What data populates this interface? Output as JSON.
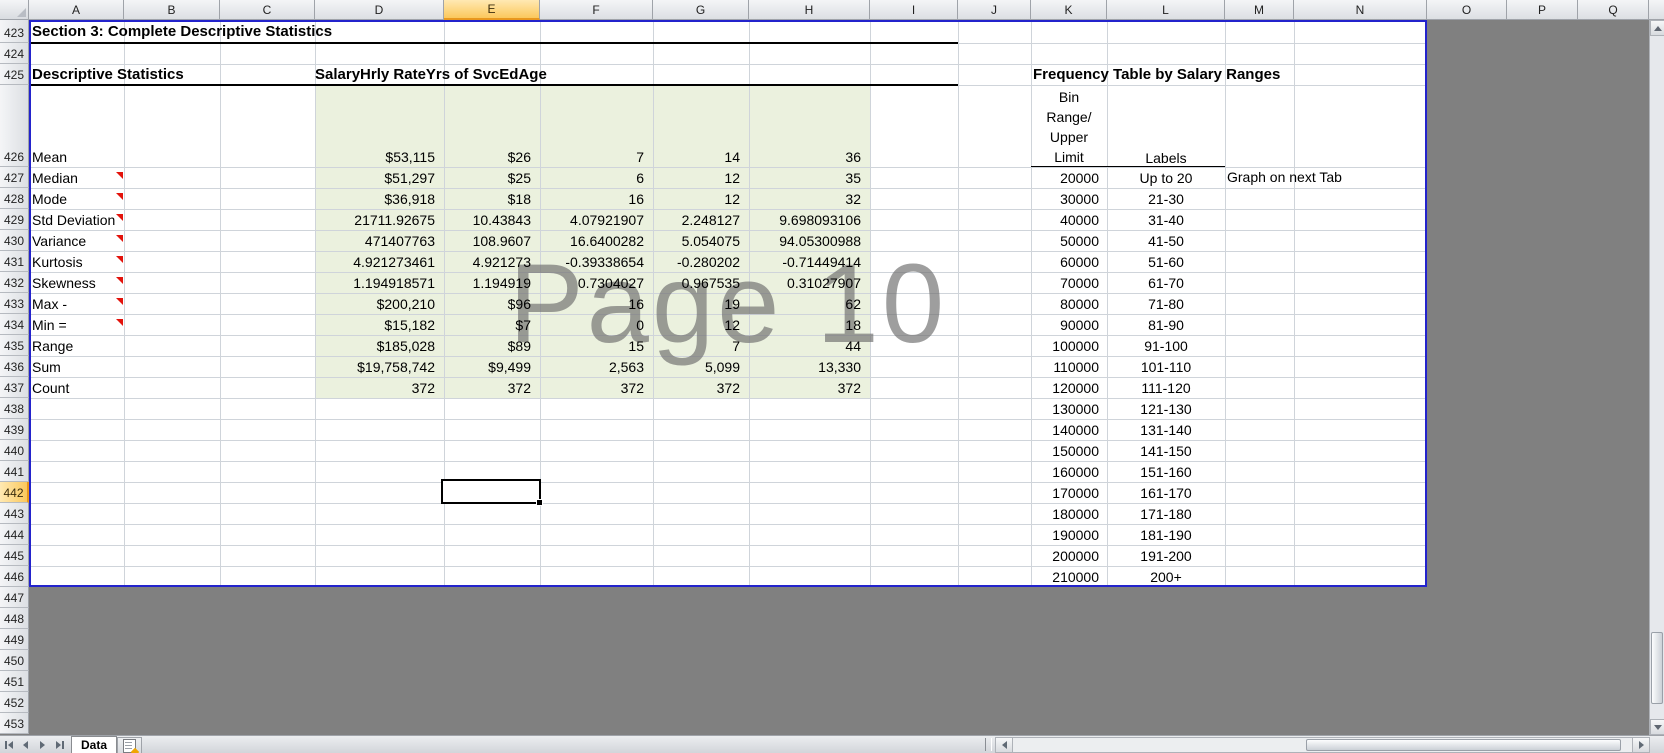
{
  "window": {
    "watermark": "Page 10"
  },
  "section": {
    "title": "Section 3: Complete Descriptive Statistics"
  },
  "grid": {
    "selected_cell": "E442",
    "columns": [
      {
        "label": "A"
      },
      {
        "label": "B"
      },
      {
        "label": "C"
      },
      {
        "label": "D"
      },
      {
        "label": "E",
        "selected": true
      },
      {
        "label": "F"
      },
      {
        "label": "G"
      },
      {
        "label": "H"
      },
      {
        "label": "I"
      },
      {
        "label": "J"
      },
      {
        "label": "K"
      },
      {
        "label": "L"
      },
      {
        "label": "M"
      },
      {
        "label": "N"
      },
      {
        "label": "O"
      },
      {
        "label": "P"
      },
      {
        "label": "Q"
      }
    ],
    "rows": [
      {
        "label": "423"
      },
      {
        "label": "424"
      },
      {
        "label": "425"
      },
      {
        "label": "426"
      },
      {
        "label": "427"
      },
      {
        "label": "428"
      },
      {
        "label": "429"
      },
      {
        "label": "430"
      },
      {
        "label": "431"
      },
      {
        "label": "432"
      },
      {
        "label": "433"
      },
      {
        "label": "434"
      },
      {
        "label": "435"
      },
      {
        "label": "436"
      },
      {
        "label": "437"
      },
      {
        "label": "438"
      },
      {
        "label": "439"
      },
      {
        "label": "440"
      },
      {
        "label": "441"
      },
      {
        "label": "442",
        "selected": true
      },
      {
        "label": "443"
      },
      {
        "label": "444"
      },
      {
        "label": "445"
      },
      {
        "label": "446"
      },
      {
        "label": "447"
      },
      {
        "label": "448"
      },
      {
        "label": "449"
      },
      {
        "label": "450"
      },
      {
        "label": "451"
      },
      {
        "label": "452"
      },
      {
        "label": "453"
      }
    ]
  },
  "stats_table": {
    "title": "Descriptive Statistics",
    "columns": [
      {
        "label": "Salary"
      },
      {
        "label": "Hrly Rate"
      },
      {
        "label": "Yrs of Svc"
      },
      {
        "label": "Ed"
      },
      {
        "label": "Age"
      }
    ],
    "rows": [
      {
        "label": "Mean",
        "comment": false,
        "values": [
          "$53,115",
          "$26",
          "7",
          "14",
          "36"
        ]
      },
      {
        "label": "Median",
        "comment": true,
        "values": [
          "$51,297",
          "$25",
          "6",
          "12",
          "35"
        ]
      },
      {
        "label": "Mode",
        "comment": true,
        "values": [
          "$36,918",
          "$18",
          "16",
          "12",
          "32"
        ]
      },
      {
        "label": "Std Deviation",
        "comment": true,
        "values": [
          "21711.92675",
          "10.43843",
          "4.07921907",
          "2.248127",
          "9.698093106"
        ]
      },
      {
        "label": "Variance",
        "comment": true,
        "values": [
          "471407763",
          "108.9607",
          "16.6400282",
          "5.054075",
          "94.05300988"
        ]
      },
      {
        "label": "Kurtosis",
        "comment": true,
        "values": [
          "4.921273461",
          "4.921273",
          "-0.39338654",
          "-0.280202",
          "-0.71449414"
        ]
      },
      {
        "label": "Skewness",
        "comment": true,
        "values": [
          "1.194918571",
          "1.194919",
          "0.7304027",
          "0.967535",
          "0.31027907"
        ]
      },
      {
        "label": "Max -",
        "comment": true,
        "values": [
          "$200,210",
          "$96",
          "16",
          "19",
          "62"
        ]
      },
      {
        "label": "Min =",
        "comment": true,
        "values": [
          "$15,182",
          "$7",
          "0",
          "12",
          "18"
        ]
      },
      {
        "label": "Range",
        "comment": false,
        "values": [
          "$185,028",
          "$89",
          "15",
          "7",
          "44"
        ]
      },
      {
        "label": "Sum",
        "comment": false,
        "values": [
          "$19,758,742",
          "$9,499",
          "2,563",
          "5,099",
          "13,330"
        ]
      },
      {
        "label": "Count",
        "comment": false,
        "values": [
          "372",
          "372",
          "372",
          "372",
          "372"
        ]
      }
    ]
  },
  "freq_table": {
    "title": "Frequency Table by Salary Ranges",
    "bin_header": "Bin\nRange/\nUpper\nLimit",
    "labels_header": "Labels",
    "note": "Graph on next Tab",
    "rows": [
      {
        "bin": "20000",
        "label": "Up to 20"
      },
      {
        "bin": "30000",
        "label": "21-30"
      },
      {
        "bin": "40000",
        "label": "31-40"
      },
      {
        "bin": "50000",
        "label": "41-50"
      },
      {
        "bin": "60000",
        "label": "51-60"
      },
      {
        "bin": "70000",
        "label": "61-70"
      },
      {
        "bin": "80000",
        "label": "71-80"
      },
      {
        "bin": "90000",
        "label": "81-90"
      },
      {
        "bin": "100000",
        "label": "91-100"
      },
      {
        "bin": "110000",
        "label": "101-110"
      },
      {
        "bin": "120000",
        "label": "111-120"
      },
      {
        "bin": "130000",
        "label": "121-130"
      },
      {
        "bin": "140000",
        "label": "131-140"
      },
      {
        "bin": "150000",
        "label": "141-150"
      },
      {
        "bin": "160000",
        "label": "151-160"
      },
      {
        "bin": "170000",
        "label": "161-170"
      },
      {
        "bin": "180000",
        "label": "171-180"
      },
      {
        "bin": "190000",
        "label": "181-190"
      },
      {
        "bin": "200000",
        "label": "191-200"
      },
      {
        "bin": "210000",
        "label": "200+"
      }
    ]
  },
  "tabs": {
    "active": "Data"
  },
  "colors": {
    "page_break_gray": "#808080",
    "print_border_blue": "#2323cc",
    "selection_amber": "#fbc85c",
    "stats_green_fill": "#ebf1de",
    "comment_red": "#e3120b"
  }
}
